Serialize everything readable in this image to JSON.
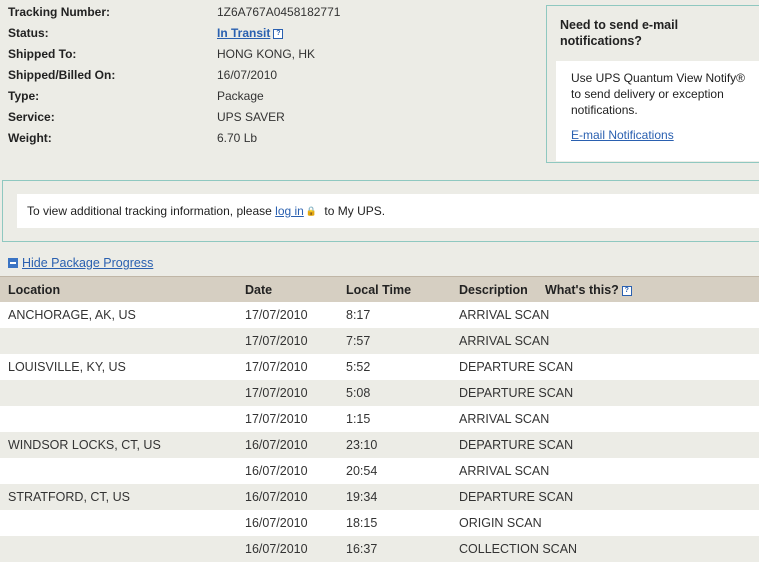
{
  "summary": {
    "rows": [
      {
        "label": "Tracking Number:",
        "value": "1Z6A767A0458182771"
      },
      {
        "label": "Status:",
        "value": "In Transit"
      },
      {
        "label": "Shipped To:",
        "value": "HONG KONG, HK"
      },
      {
        "label": "Shipped/Billed On:",
        "value": "16/07/2010"
      },
      {
        "label": "Type:",
        "value": "Package"
      },
      {
        "label": "Service:",
        "value": "UPS SAVER"
      },
      {
        "label": "Weight:",
        "value": "6.70 Lb"
      }
    ]
  },
  "notify": {
    "title": "Need to send e-mail notifications?",
    "text": "Use UPS Quantum View Notify® to send delivery or exception notifications.",
    "link": "E-mail Notifications"
  },
  "login": {
    "before": "To view additional tracking information, please",
    "link": "log in",
    "after": "to My UPS."
  },
  "progress_toggle": "Hide Package Progress",
  "table": {
    "headers": {
      "location": "Location",
      "date": "Date",
      "time": "Local Time",
      "description": "Description",
      "whats_this": "What's this?"
    },
    "rows": [
      {
        "location": "ANCHORAGE, AK, US",
        "date": "17/07/2010",
        "time": "8:17",
        "description": "ARRIVAL SCAN"
      },
      {
        "location": "",
        "date": "17/07/2010",
        "time": "7:57",
        "description": "ARRIVAL SCAN"
      },
      {
        "location": "LOUISVILLE, KY, US",
        "date": "17/07/2010",
        "time": "5:52",
        "description": "DEPARTURE SCAN"
      },
      {
        "location": "",
        "date": "17/07/2010",
        "time": "5:08",
        "description": "DEPARTURE SCAN"
      },
      {
        "location": "",
        "date": "17/07/2010",
        "time": "1:15",
        "description": "ARRIVAL SCAN"
      },
      {
        "location": "WINDSOR LOCKS, CT, US",
        "date": "16/07/2010",
        "time": "23:10",
        "description": "DEPARTURE SCAN"
      },
      {
        "location": "",
        "date": "16/07/2010",
        "time": "20:54",
        "description": "ARRIVAL SCAN"
      },
      {
        "location": "STRATFORD, CT, US",
        "date": "16/07/2010",
        "time": "19:34",
        "description": "DEPARTURE SCAN"
      },
      {
        "location": "",
        "date": "16/07/2010",
        "time": "18:15",
        "description": "ORIGIN SCAN"
      },
      {
        "location": "",
        "date": "16/07/2010",
        "time": "16:37",
        "description": "COLLECTION SCAN"
      }
    ]
  },
  "icons": {
    "help": "help-icon",
    "lock": "lock-icon",
    "collapse": "minus-icon"
  },
  "colors": {
    "link": "#2a60b0",
    "header_bg": "#d6cfc2",
    "box_border": "#8fc8c0",
    "page_bg": "#ecece6"
  }
}
